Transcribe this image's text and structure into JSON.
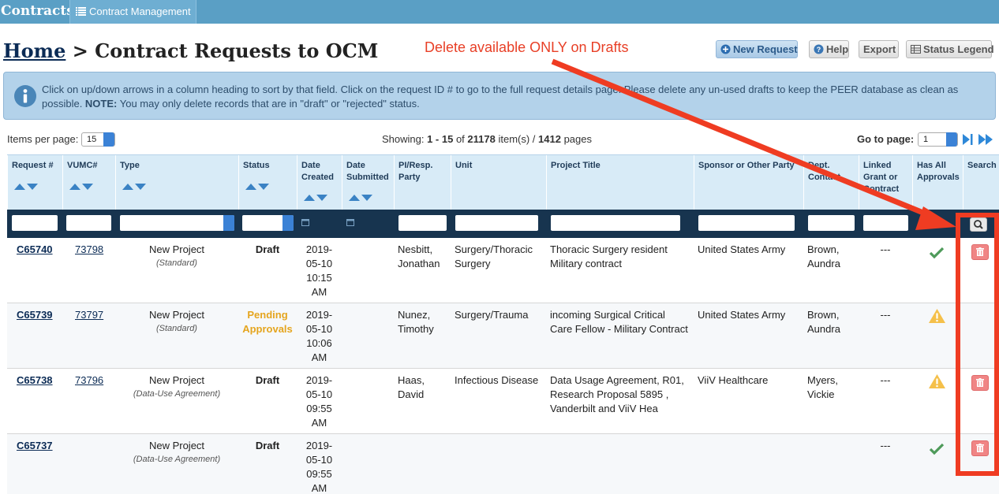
{
  "topbar": {
    "brand": "Contracts",
    "nav_label": "Contract Management"
  },
  "page": {
    "title_home": "Home",
    "title_rest": " > Contract Requests to OCM",
    "annotation": "Delete available ONLY on Drafts"
  },
  "toolbar": {
    "new_request": "New Request",
    "help": "Help",
    "export": "Export",
    "status_legend": "Status Legend"
  },
  "info": {
    "text_a": "Click on up/down arrows in a column heading to sort by that field. Click on the request ID # to go to the full request details page. Please delete any un-used drafts to keep the PEER database as clean as possible. ",
    "note_label": "NOTE:",
    "text_b": " You may only delete records that are in \"draft\" or \"rejected\" status."
  },
  "pager": {
    "items_per_page_label": "Items per page:",
    "items_per_page_value": "15",
    "showing_prefix": "Showing: ",
    "showing_range": "1 - 15",
    "showing_of": " of ",
    "total_items": "21178",
    "items_suffix": " item(s) / ",
    "total_pages": "1412",
    "pages_suffix": " pages",
    "goto_label": "Go to page:",
    "goto_value": "1"
  },
  "columns": {
    "request": "Request #",
    "vumc": "VUMC#",
    "type": "Type",
    "status": "Status",
    "date_created": "Date Created",
    "date_submitted": "Date Submitted",
    "pi": "PI/Resp. Party",
    "unit": "Unit",
    "project": "Project Title",
    "sponsor": "Sponsor or Other Party",
    "dept": "Dept. Contact",
    "linked": "Linked Grant or Contract",
    "approvals": "Has All Approvals",
    "search": "Search"
  },
  "rows": [
    {
      "id": "C65740",
      "vumc": "73798",
      "type": "New Project",
      "subtype": "(Standard)",
      "status": "Draft",
      "status_kind": "draft",
      "date1": "2019-",
      "date2": "05-10",
      "date3": "10:15",
      "date4": "AM",
      "pi1": "Nesbitt,",
      "pi2": "Jonathan",
      "unit1": "Surgery/Thoracic",
      "unit2": "Surgery",
      "title1": "Thoracic Surgery resident",
      "title2": "Military contract",
      "title3": "",
      "sponsor": "United States Army",
      "dept1": "Brown,",
      "dept2": "Aundra",
      "linked": "---",
      "approval": "check-icon",
      "deletable": true
    },
    {
      "id": "C65739",
      "vumc": "73797",
      "type": "New Project",
      "subtype": "(Standard)",
      "status": "Pending Approvals",
      "status_line1": "Pending",
      "status_line2": "Approvals",
      "status_kind": "pending",
      "date1": "2019-",
      "date2": "05-10",
      "date3": "10:06",
      "date4": "AM",
      "pi1": "Nunez,",
      "pi2": "Timothy",
      "unit1": "Surgery/Trauma",
      "unit2": "",
      "title1": "incoming Surgical Critical",
      "title2": "Care Fellow - Military Contract",
      "title3": "",
      "sponsor": "United States Army",
      "dept1": "Brown,",
      "dept2": "Aundra",
      "linked": "---",
      "approval": "warning-icon",
      "deletable": false
    },
    {
      "id": "C65738",
      "vumc": "73796",
      "type": "New Project",
      "subtype": "(Data-Use Agreement)",
      "status": "Draft",
      "status_kind": "draft",
      "date1": "2019-",
      "date2": "05-10",
      "date3": "09:55",
      "date4": "AM",
      "pi1": "Haas,",
      "pi2": "David",
      "unit1": "Infectious Disease",
      "unit2": "",
      "title1": "Data Usage Agreement, R01,",
      "title2": "Research Proposal 5895 ,",
      "title3": "Vanderbilt and ViiV Hea",
      "sponsor": "ViiV Healthcare",
      "dept1": "Myers,",
      "dept2": "Vickie",
      "linked": "---",
      "approval": "warning-icon",
      "deletable": true
    },
    {
      "id": "C65737",
      "vumc": "",
      "type": "New Project",
      "subtype": "(Data-Use Agreement)",
      "status": "Draft",
      "status_kind": "draft",
      "date1": "2019-",
      "date2": "05-10",
      "date3": "09:55",
      "date4": "AM",
      "pi1": "",
      "pi2": "",
      "unit1": "",
      "unit2": "",
      "title1": "",
      "title2": "",
      "title3": "",
      "sponsor": "",
      "dept1": "",
      "dept2": "",
      "linked": "---",
      "approval": "check-icon",
      "deletable": true
    }
  ],
  "colors": {
    "topbar": "#5a9fc5",
    "annotation": "#ef3c22",
    "pending": "#e5a51e",
    "check": "#4e9a5a",
    "warning": "#f5c04a",
    "delete": "#f08585"
  }
}
